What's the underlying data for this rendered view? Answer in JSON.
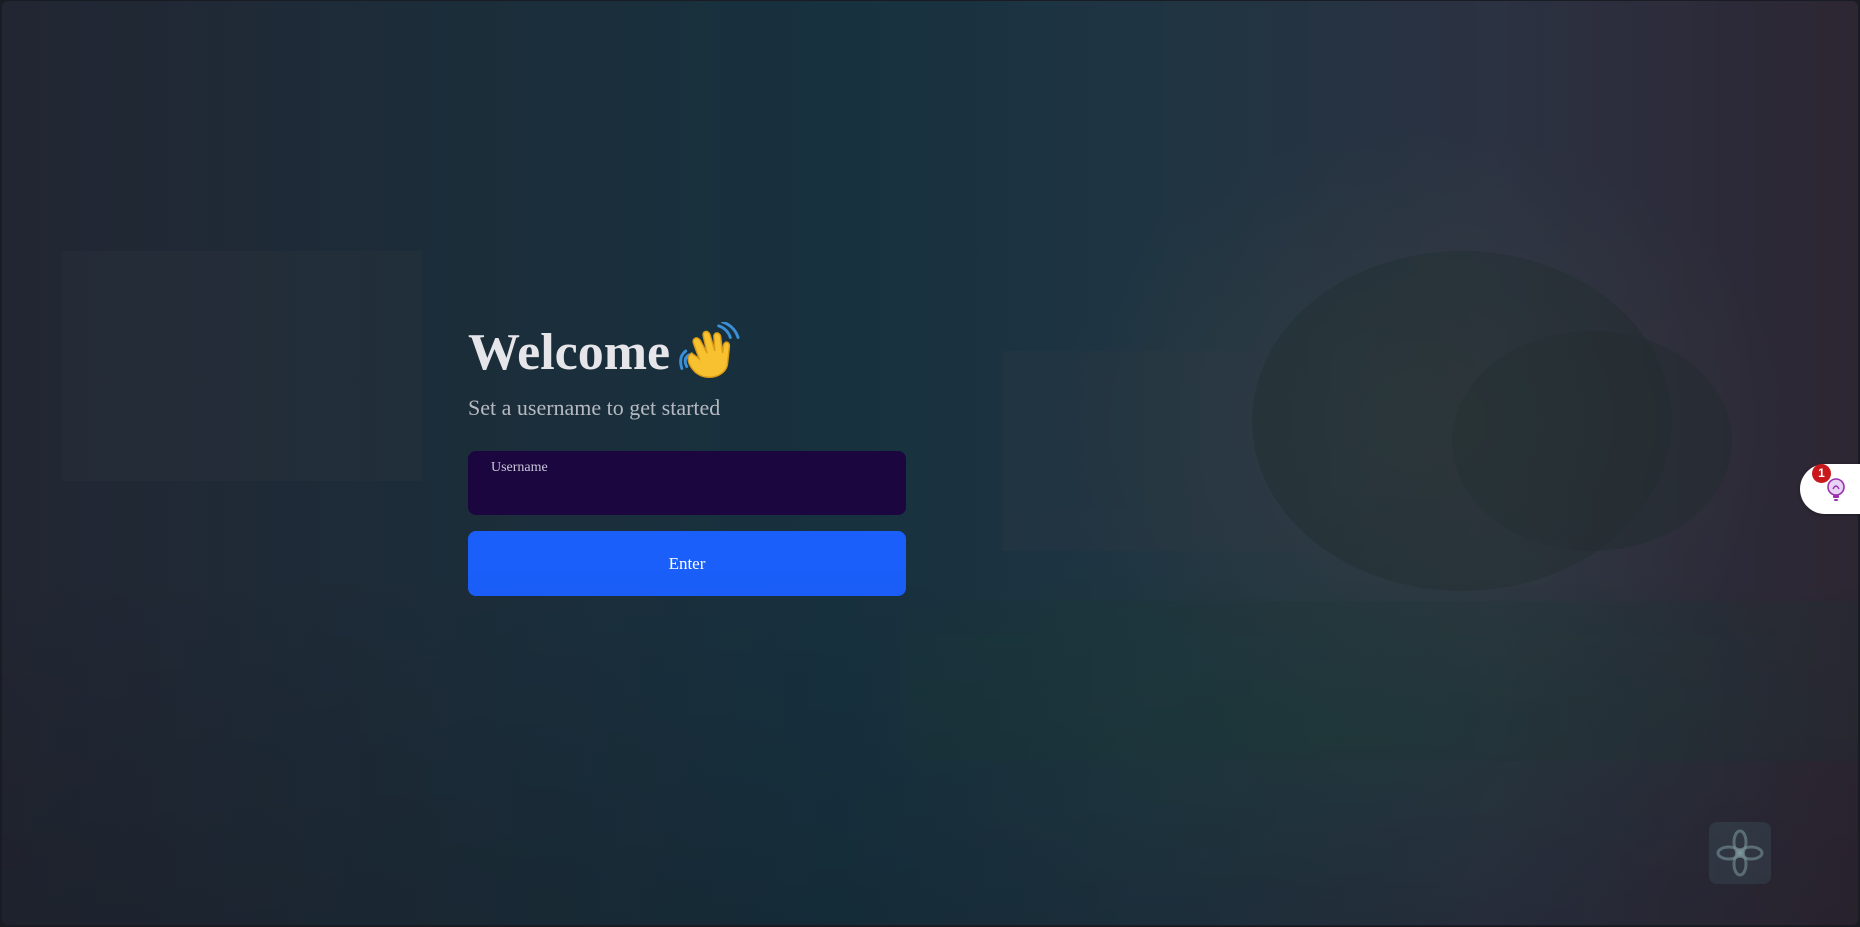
{
  "login": {
    "title": "Welcome",
    "title_emoji": "waving-hand-icon",
    "subtitle": "Set a username to get started",
    "username_label": "Username",
    "username_value": "",
    "enter_label": "Enter"
  },
  "floating_widget": {
    "icon": "lightbulb-icon",
    "badge_count": "1"
  },
  "corner_logo": {
    "icon": "flower-logo-icon"
  },
  "colors": {
    "input_bg": "#1b0640",
    "button_bg": "#1a5ffa",
    "badge_bg": "#c8181c"
  }
}
